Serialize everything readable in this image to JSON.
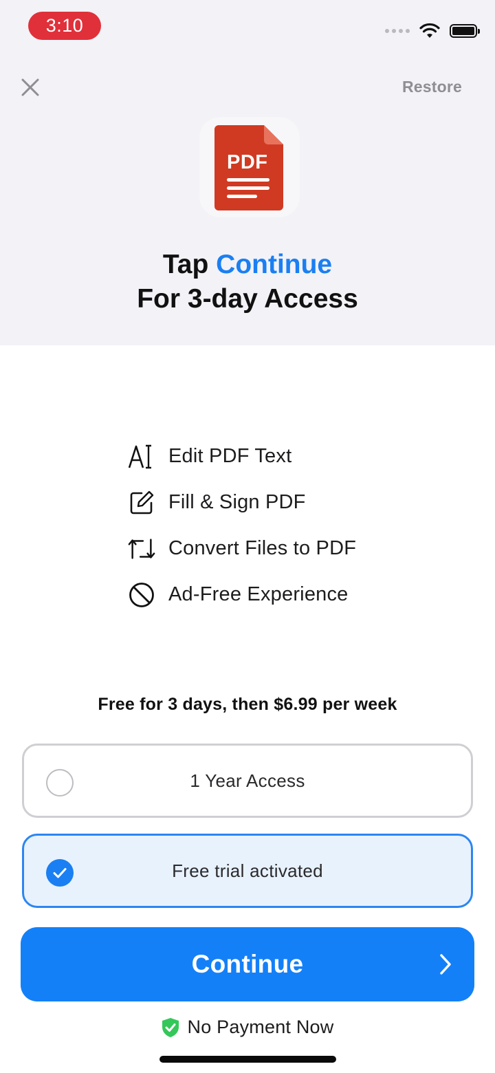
{
  "status_bar": {
    "time": "3:10"
  },
  "header": {
    "restore_label": "Restore"
  },
  "app_icon": {
    "label": "PDF",
    "color": "#d03a22"
  },
  "headline": {
    "prefix": "Tap ",
    "accent": "Continue",
    "line2": "For 3-day Access"
  },
  "features": [
    {
      "icon": "text-cursor-icon",
      "label": "Edit PDF Text"
    },
    {
      "icon": "edit-square-icon",
      "label": "Fill & Sign PDF"
    },
    {
      "icon": "convert-arrows-icon",
      "label": "Convert Files to PDF"
    },
    {
      "icon": "no-ads-icon",
      "label": "Ad-Free Experience"
    }
  ],
  "pricing": {
    "summary": "Free for 3 days, then $6.99 per week",
    "options": [
      {
        "label": "1 Year Access",
        "selected": false
      },
      {
        "label": "Free trial activated",
        "selected": true
      }
    ]
  },
  "cta": {
    "continue_label": "Continue",
    "no_payment_label": "No Payment Now"
  },
  "colors": {
    "accent": "#1a7ff2",
    "button": "#1480f8",
    "time_pill": "#e0303a",
    "shield": "#34c759"
  }
}
